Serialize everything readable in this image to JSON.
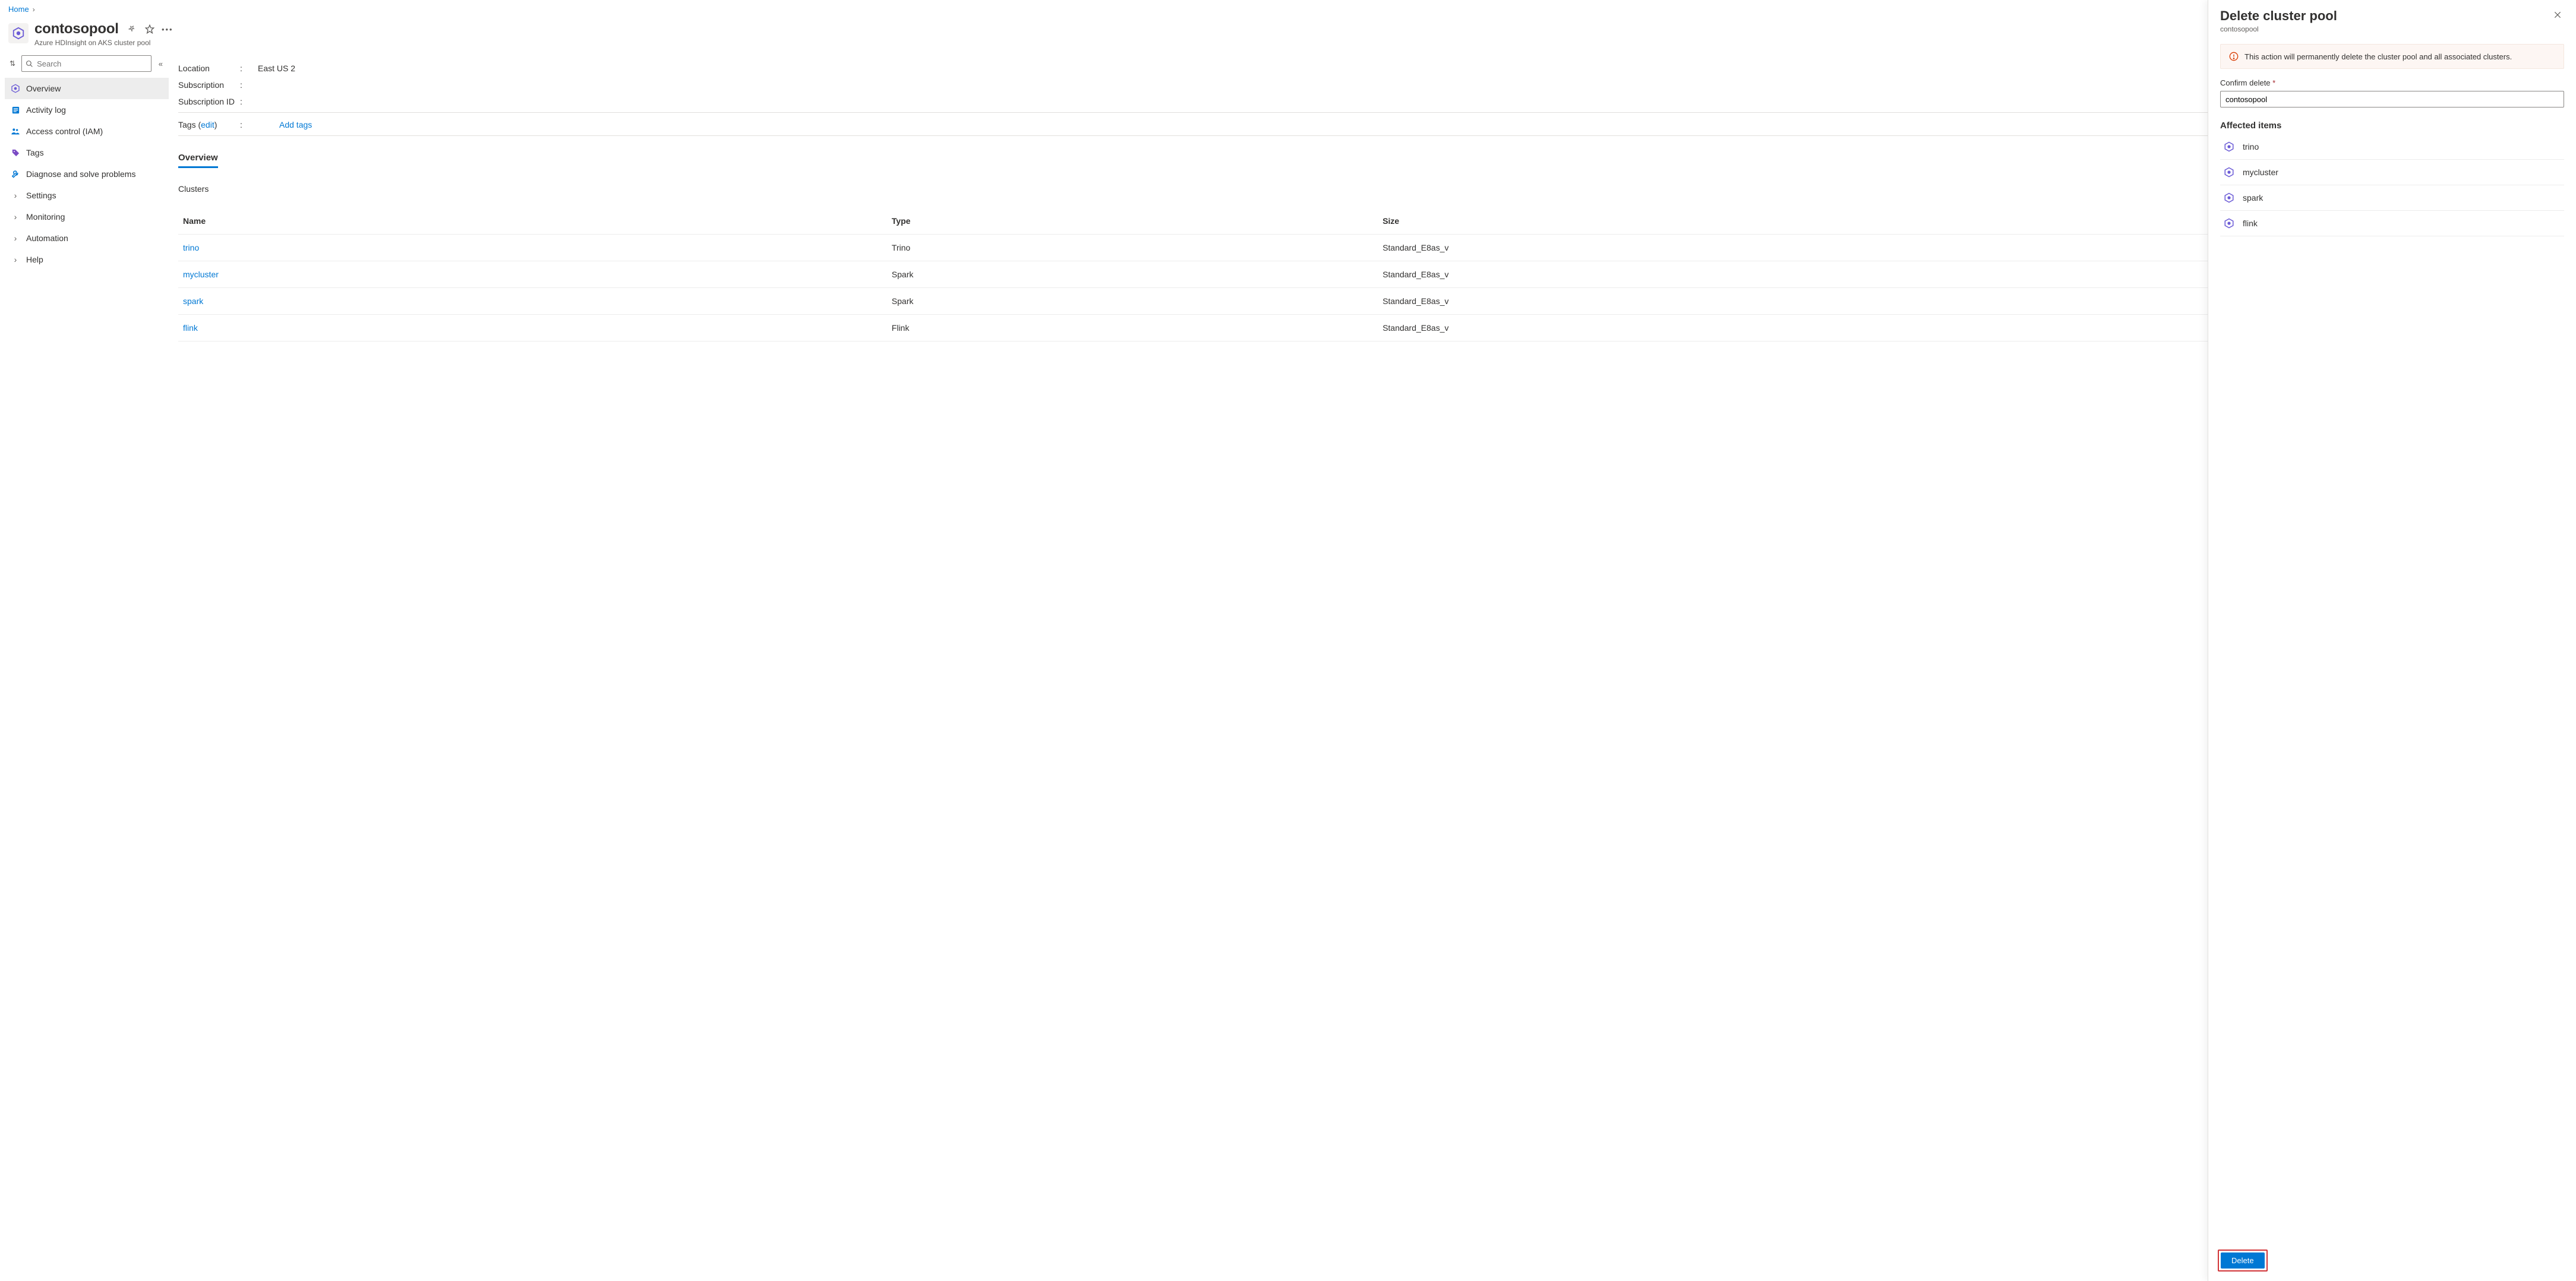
{
  "breadcrumb": {
    "home": "Home"
  },
  "header": {
    "title": "contosopool",
    "subtitle": "Azure HDInsight on AKS cluster pool"
  },
  "sidebar": {
    "search_placeholder": "Search",
    "items": [
      {
        "label": "Overview",
        "icon": "hex"
      },
      {
        "label": "Activity log",
        "icon": "log"
      },
      {
        "label": "Access control (IAM)",
        "icon": "people"
      },
      {
        "label": "Tags",
        "icon": "tag"
      },
      {
        "label": "Diagnose and solve problems",
        "icon": "wrench"
      },
      {
        "label": "Settings",
        "icon": "chev"
      },
      {
        "label": "Monitoring",
        "icon": "chev"
      },
      {
        "label": "Automation",
        "icon": "chev"
      },
      {
        "label": "Help",
        "icon": "chev"
      }
    ]
  },
  "essentials": {
    "location_label": "Location",
    "location_value": "East US 2",
    "subscription_label": "Subscription",
    "subscription_value": "",
    "subscription_id_label": "Subscription ID",
    "subscription_id_value": "",
    "tags_label": "Tags",
    "tags_edit": "edit",
    "add_tags": "Add tags"
  },
  "tabs": {
    "overview": "Overview"
  },
  "clusters": {
    "section_label": "Clusters",
    "columns": {
      "name": "Name",
      "type": "Type",
      "size": "Size"
    },
    "rows": [
      {
        "name": "trino",
        "type": "Trino",
        "size": "Standard_E8as_v"
      },
      {
        "name": "mycluster",
        "type": "Spark",
        "size": "Standard_E8as_v"
      },
      {
        "name": "spark",
        "type": "Spark",
        "size": "Standard_E8as_v"
      },
      {
        "name": "flink",
        "type": "Flink",
        "size": "Standard_E8as_v"
      }
    ]
  },
  "blade": {
    "title": "Delete cluster pool",
    "subtitle": "contosopool",
    "warning": "This action will permanently delete the cluster pool and all associated clusters.",
    "confirm_label": "Confirm delete",
    "confirm_value": "contosopool",
    "affected_label": "Affected items",
    "affected": [
      {
        "name": "trino"
      },
      {
        "name": "mycluster"
      },
      {
        "name": "spark"
      },
      {
        "name": "flink"
      }
    ],
    "delete_button": "Delete"
  }
}
